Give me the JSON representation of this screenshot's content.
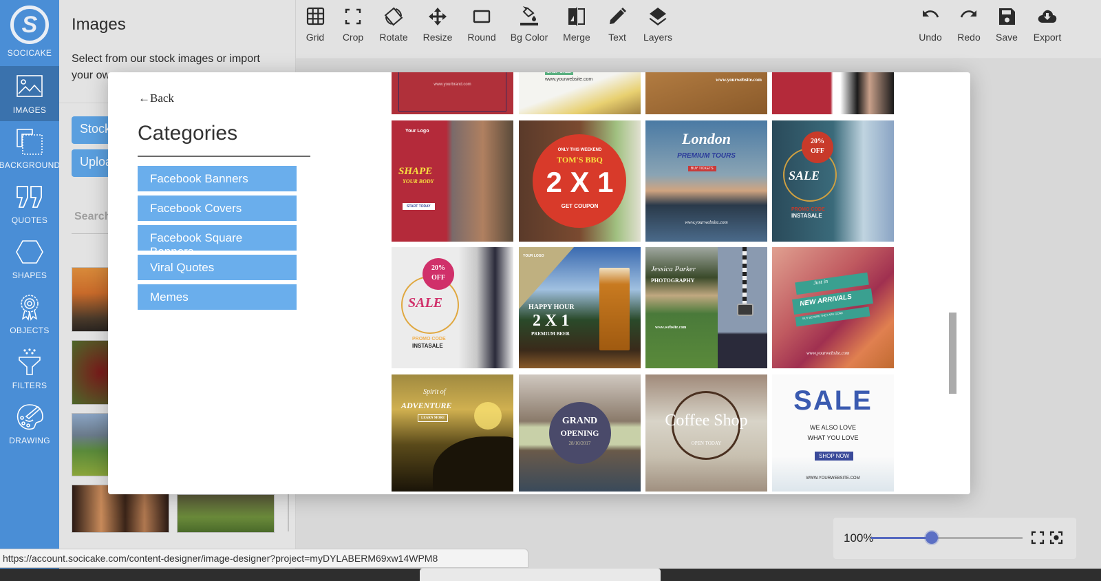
{
  "nav": {
    "brand": "SOCICAKE",
    "items": [
      {
        "label": "IMAGES",
        "icon": "image-icon",
        "active": true
      },
      {
        "label": "BACKGROUND",
        "icon": "background-icon"
      },
      {
        "label": "QUOTES",
        "icon": "quotes-icon"
      },
      {
        "label": "SHAPES",
        "icon": "hexagon-icon"
      },
      {
        "label": "OBJECTS",
        "icon": "badge-icon"
      },
      {
        "label": "FILTERS",
        "icon": "funnel-icon"
      },
      {
        "label": "DRAWING",
        "icon": "palette-icon"
      }
    ]
  },
  "panel": {
    "title": "Images",
    "description": "Select from our stock images or import your own",
    "stock_button": "Stock",
    "upload_button": "Upload",
    "search_placeholder": "Search"
  },
  "toolbar": {
    "tools": [
      {
        "label": "Grid",
        "icon": "grid-icon"
      },
      {
        "label": "Crop",
        "icon": "crop-icon"
      },
      {
        "label": "Rotate",
        "icon": "rotate-icon"
      },
      {
        "label": "Resize",
        "icon": "resize-icon"
      },
      {
        "label": "Round",
        "icon": "round-icon"
      },
      {
        "label": "Bg Color",
        "icon": "paint-bucket-icon"
      },
      {
        "label": "Merge",
        "icon": "merge-icon"
      },
      {
        "label": "Text",
        "icon": "pencil-icon"
      },
      {
        "label": "Layers",
        "icon": "layers-icon"
      }
    ],
    "actions": [
      {
        "label": "Undo",
        "icon": "undo-icon"
      },
      {
        "label": "Redo",
        "icon": "redo-icon"
      },
      {
        "label": "Save",
        "icon": "save-icon"
      },
      {
        "label": "Export",
        "icon": "cloud-download-icon"
      }
    ]
  },
  "modal": {
    "back_label": "Back",
    "categories_title": "Categories",
    "categories": [
      "Facebook Banners",
      "Facebook Covers",
      "Facebook Square Banners",
      "Viral Quotes",
      "Memes"
    ],
    "templates": [
      {
        "name": "brand-red",
        "texts": [
          "www.yourbrand.com"
        ]
      },
      {
        "name": "shop-sale",
        "texts": [
          "SHOP SALE",
          "www.yourwebsite.com"
        ]
      },
      {
        "name": "restaurant",
        "texts": [
          "www.yourwebsite.com"
        ]
      },
      {
        "name": "fitness-top",
        "texts": []
      },
      {
        "name": "shape-your-body",
        "texts": [
          "Your Logo",
          "SHAPE",
          "YOUR BODY",
          "START TODAY"
        ]
      },
      {
        "name": "toms-bbq",
        "texts": [
          "ONLY THIS WEEKEND",
          "TOM'S BBQ",
          "2 X 1",
          "GET COUPON"
        ]
      },
      {
        "name": "london-tours",
        "texts": [
          "London",
          "PREMIUM TOURS",
          "BUY TICKETS",
          "www.yourwebsite.com"
        ]
      },
      {
        "name": "instasale-denim",
        "texts": [
          "20%",
          "OFF",
          "SALE",
          "PROMO CODE",
          "INSTASALE"
        ]
      },
      {
        "name": "instasale-white",
        "texts": [
          "20%",
          "OFF",
          "SALE",
          "PROMO CODE",
          "INSTASALE"
        ]
      },
      {
        "name": "happy-hour",
        "texts": [
          "YOUR LOGO",
          "HAPPY HOUR",
          "2 X 1",
          "PREMIUM BEER"
        ]
      },
      {
        "name": "jessica-parker",
        "texts": [
          "Jessica Parker",
          "PHOTOGRAPHY",
          "www.website.com"
        ]
      },
      {
        "name": "new-arrivals",
        "texts": [
          "Just in",
          "NEW ARRIVALS",
          "BUY BEFORE THEY ARE GONE",
          "www.yourwebsite.com"
        ]
      },
      {
        "name": "spirit-of-adventure",
        "texts": [
          "Spirit of",
          "ADVENTURE",
          "LEARN MORE"
        ]
      },
      {
        "name": "grand-opening",
        "texts": [
          "GRAND",
          "OPENING",
          "28/10/2017"
        ]
      },
      {
        "name": "coffee-shop",
        "texts": [
          "Coffee Shop",
          "OPEN TODAY"
        ]
      },
      {
        "name": "sale-blue",
        "texts": [
          "SALE",
          "WE ALSO LOVE",
          "WHAT YOU LOVE",
          "SHOP NOW",
          "WWW.YOURWEBSITE.COM"
        ]
      }
    ]
  },
  "zoom": {
    "label": "100%",
    "value_fraction": 0.4
  },
  "status_url": "https://account.socicake.com/content-designer/image-designer?project=myDYLABERM69xw14WPM8",
  "colors": {
    "nav": "#4a8ed6",
    "category_button": "#6aaeec",
    "slider": "#5b6fc4"
  }
}
